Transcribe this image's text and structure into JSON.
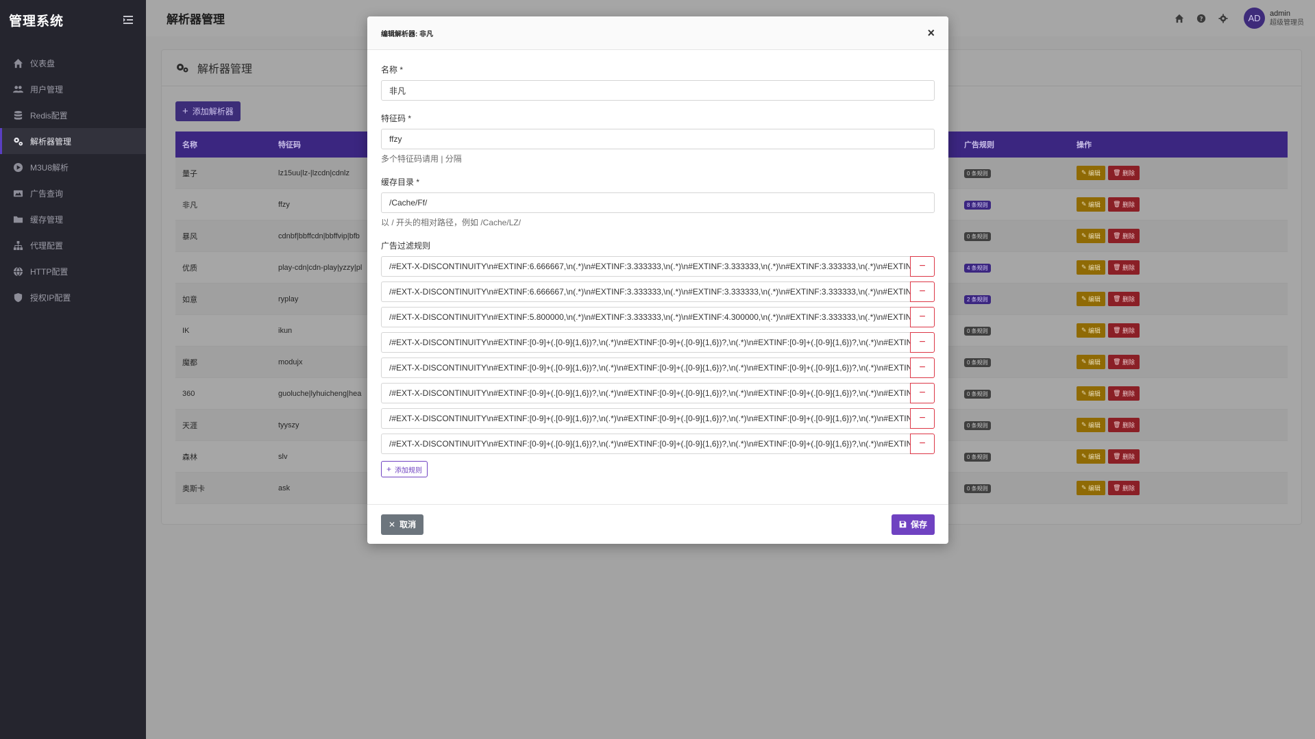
{
  "sidebar": {
    "brand": "管理系统",
    "items": [
      {
        "label": "仪表盘",
        "icon": "home-icon"
      },
      {
        "label": "用户管理",
        "icon": "users-icon"
      },
      {
        "label": "Redis配置",
        "icon": "database-icon"
      },
      {
        "label": "解析器管理",
        "icon": "cogs-icon",
        "active": true
      },
      {
        "label": "M3U8解析",
        "icon": "play-circle-icon"
      },
      {
        "label": "广告查询",
        "icon": "image-icon"
      },
      {
        "label": "缓存管理",
        "icon": "folder-icon"
      },
      {
        "label": "代理配置",
        "icon": "sitemap-icon"
      },
      {
        "label": "HTTP配置",
        "icon": "globe-icon"
      },
      {
        "label": "授权IP配置",
        "icon": "shield-icon"
      }
    ]
  },
  "header": {
    "title": "解析器管理",
    "avatar": "AD",
    "user_name": "admin",
    "user_role": "超级管理员"
  },
  "card": {
    "title": "解析器管理",
    "add_button": "添加解析器"
  },
  "table": {
    "columns": {
      "name": "名称",
      "signature": "特征码",
      "ad_rules": "广告规则",
      "actions": "操作"
    },
    "edit_label": "编辑",
    "delete_label": "删除",
    "rows": [
      {
        "name": "量子",
        "signature": "lz15uu|lz-|lzcdn|cdnlz",
        "ad": "0 条规则",
        "has": false
      },
      {
        "name": "非凡",
        "signature": "ffzy",
        "ad": "8 条规则",
        "has": true
      },
      {
        "name": "暴风",
        "signature": "cdnbf|bbffcdn|bbffvip|bfb",
        "ad": "0 条规则",
        "has": false
      },
      {
        "name": "优质",
        "signature": "play-cdn|cdn-play|yzzy|pl",
        "ad": "4 条规则",
        "has": true
      },
      {
        "name": "如意",
        "signature": "ryplay",
        "ad": "2 条规则",
        "has": true
      },
      {
        "name": "IK",
        "signature": "ikun",
        "ad": "0 条规则",
        "has": false
      },
      {
        "name": "魔都",
        "signature": "modujx",
        "ad": "0 条规则",
        "has": false
      },
      {
        "name": "360",
        "signature": "guoluche|lyhuicheng|hea",
        "ad": "0 条规则",
        "has": false
      },
      {
        "name": "天涯",
        "signature": "tyyszy",
        "ad": "0 条规则",
        "has": false
      },
      {
        "name": "森林",
        "signature": "slv",
        "ad": "0 条规则",
        "has": false
      },
      {
        "name": "奥斯卡",
        "signature": "ask",
        "ad": "0 条规则",
        "has": false
      }
    ]
  },
  "modal": {
    "title": "编辑解析器: 非凡",
    "close": "×",
    "name_label": "名称 *",
    "name_value": "非凡",
    "signature_label": "特征码 *",
    "signature_value": "ffzy",
    "signature_help": "多个特征码请用 | 分隔",
    "cache_label": "缓存目录 *",
    "cache_value": "/Cache/Ff/",
    "cache_help": "以 / 开头的相对路径，例如 /Cache/LZ/",
    "rules_label": "广告过滤规则",
    "rules": [
      "/#EXT-X-DISCONTINUITY\\n#EXTINF:6.666667,\\n(.*)\\n#EXTINF:3.333333,\\n(.*)\\n#EXTINF:3.333333,\\n(.*)\\n#EXTINF:3.333333,\\n(.*)\\n#EXTIN",
      "/#EXT-X-DISCONTINUITY\\n#EXTINF:6.666667,\\n(.*)\\n#EXTINF:3.333333,\\n(.*)\\n#EXTINF:3.333333,\\n(.*)\\n#EXTINF:3.333333,\\n(.*)\\n#EXTIN",
      "/#EXT-X-DISCONTINUITY\\n#EXTINF:5.800000,\\n(.*)\\n#EXTINF:3.333333,\\n(.*)\\n#EXTINF:4.300000,\\n(.*)\\n#EXTINF:3.333333,\\n(.*)\\n#EXTIN",
      "/#EXT-X-DISCONTINUITY\\n#EXTINF:[0-9]+(.[0-9]{1,6})?,\\n(.*)\\n#EXTINF:[0-9]+(.[0-9]{1,6})?,\\n(.*)\\n#EXTINF:[0-9]+(.[0-9]{1,6})?,\\n(.*)\\n#EXTIN",
      "/#EXT-X-DISCONTINUITY\\n#EXTINF:[0-9]+(.[0-9]{1,6})?,\\n(.*)\\n#EXTINF:[0-9]+(.[0-9]{1,6})?,\\n(.*)\\n#EXTINF:[0-9]+(.[0-9]{1,6})?,\\n(.*)\\n#EXTIN",
      "/#EXT-X-DISCONTINUITY\\n#EXTINF:[0-9]+(.[0-9]{1,6})?,\\n(.*)\\n#EXTINF:[0-9]+(.[0-9]{1,6})?,\\n(.*)\\n#EXTINF:[0-9]+(.[0-9]{1,6})?,\\n(.*)\\n#EXTIN",
      "/#EXT-X-DISCONTINUITY\\n#EXTINF:[0-9]+(.[0-9]{1,6})?,\\n(.*)\\n#EXTINF:[0-9]+(.[0-9]{1,6})?,\\n(.*)\\n#EXTINF:[0-9]+(.[0-9]{1,6})?,\\n(.*)\\n#EXTIN",
      "/#EXT-X-DISCONTINUITY\\n#EXTINF:[0-9]+(.[0-9]{1,6})?,\\n(.*)\\n#EXTINF:[0-9]+(.[0-9]{1,6})?,\\n(.*)\\n#EXTINF:[0-9]+(.[0-9]{1,6})?,\\n(.*)\\n#EXTIN"
    ],
    "add_rule": "添加规则",
    "cancel": "取消",
    "save": "保存"
  },
  "colors": {
    "sidebar_bg": "#25252e",
    "primary": "#6f42c1",
    "danger": "#dc3545",
    "secondary": "#6c757d"
  }
}
